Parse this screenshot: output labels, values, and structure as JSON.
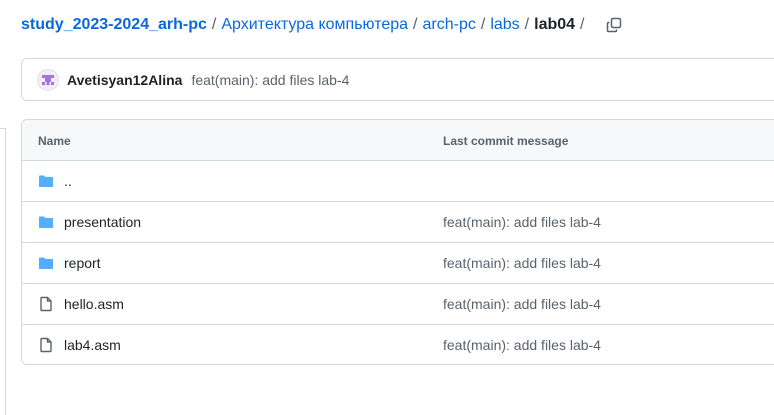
{
  "breadcrumb": {
    "repo": "study_2023-2024_arh-pc",
    "sep1": "/",
    "folder1": "Архитектура компьютера",
    "sep2": "/",
    "folder2": "arch-pc",
    "sep3": "/",
    "folder3": "labs",
    "sep4": "/",
    "current": "lab04",
    "sep5": "/",
    "copy_icon": "copy-icon"
  },
  "latest_commit": {
    "author": "Avetisyan12Alina",
    "message": "feat(main): add files lab-4",
    "avatar_icon": "identicon"
  },
  "table": {
    "headers": {
      "name": "Name",
      "last_commit_message": "Last commit message"
    },
    "rows": [
      {
        "type": "dir",
        "icon": "folder-icon",
        "name": "..",
        "message": ""
      },
      {
        "type": "dir",
        "icon": "folder-icon",
        "name": "presentation",
        "message": "feat(main): add files lab-4"
      },
      {
        "type": "dir",
        "icon": "folder-icon",
        "name": "report",
        "message": "feat(main): add files lab-4"
      },
      {
        "type": "file",
        "icon": "file-icon",
        "name": "hello.asm",
        "message": "feat(main): add files lab-4"
      },
      {
        "type": "file",
        "icon": "file-icon",
        "name": "lab4.asm",
        "message": "feat(main): add files lab-4"
      }
    ]
  },
  "colors": {
    "link": "#0969da",
    "folder": "#54aeff",
    "muted": "#59636e",
    "border": "#d1d9e0",
    "header_bg": "#f6f8fa"
  }
}
